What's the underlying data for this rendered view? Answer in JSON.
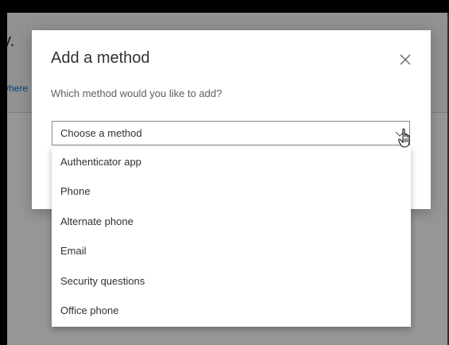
{
  "page": {
    "title_fragment": "y.",
    "link_fragment": "vhere"
  },
  "dialog": {
    "title": "Add a method",
    "close_icon": "close-icon",
    "prompt": "Which method would you like to add?",
    "select": {
      "value": "Choose a method",
      "arrow_icon": "chevron-down-icon"
    },
    "options": [
      {
        "label": "Authenticator app"
      },
      {
        "label": "Phone"
      },
      {
        "label": "Alternate phone"
      },
      {
        "label": "Email"
      },
      {
        "label": "Security questions"
      },
      {
        "label": "Office phone"
      }
    ]
  },
  "cursor_icon": "hand-pointer-icon",
  "colors": {
    "link": "#0067b8",
    "text": "#323130",
    "muted": "#605e5c",
    "border": "#8a8886"
  }
}
